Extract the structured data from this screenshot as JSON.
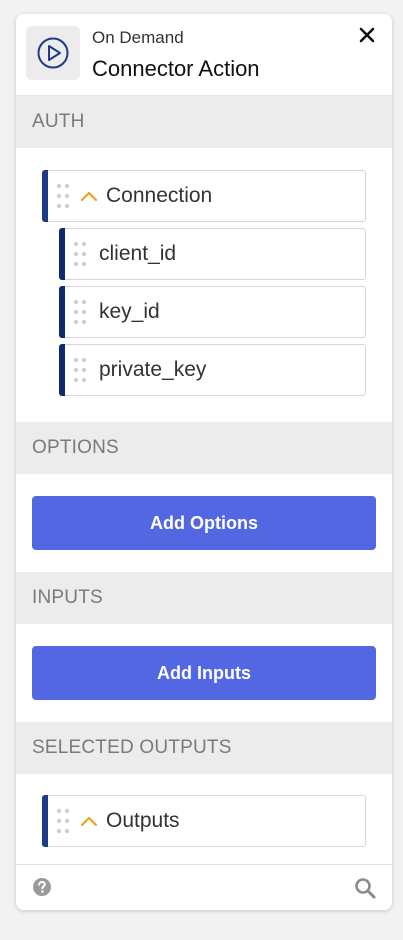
{
  "header": {
    "subtitle": "On Demand",
    "title": "Connector Action",
    "icon": "play-circle-icon",
    "close_icon": "close-icon"
  },
  "sections": {
    "auth": {
      "title": "AUTH",
      "group_label": "Connection",
      "fields": [
        "client_id",
        "key_id",
        "private_key"
      ]
    },
    "options": {
      "title": "OPTIONS",
      "button_label": "Add Options"
    },
    "inputs": {
      "title": "INPUTS",
      "button_label": "Add Inputs"
    },
    "outputs": {
      "title": "SELECTED OUTPUTS",
      "group_label": "Outputs"
    }
  },
  "footer": {
    "help_icon": "help-icon",
    "search_icon": "search-icon"
  },
  "colors": {
    "accent_button": "#5467e3",
    "card_bar": "#1e3a8a",
    "chevron": "#f0a020",
    "section_bg": "#ececec"
  }
}
